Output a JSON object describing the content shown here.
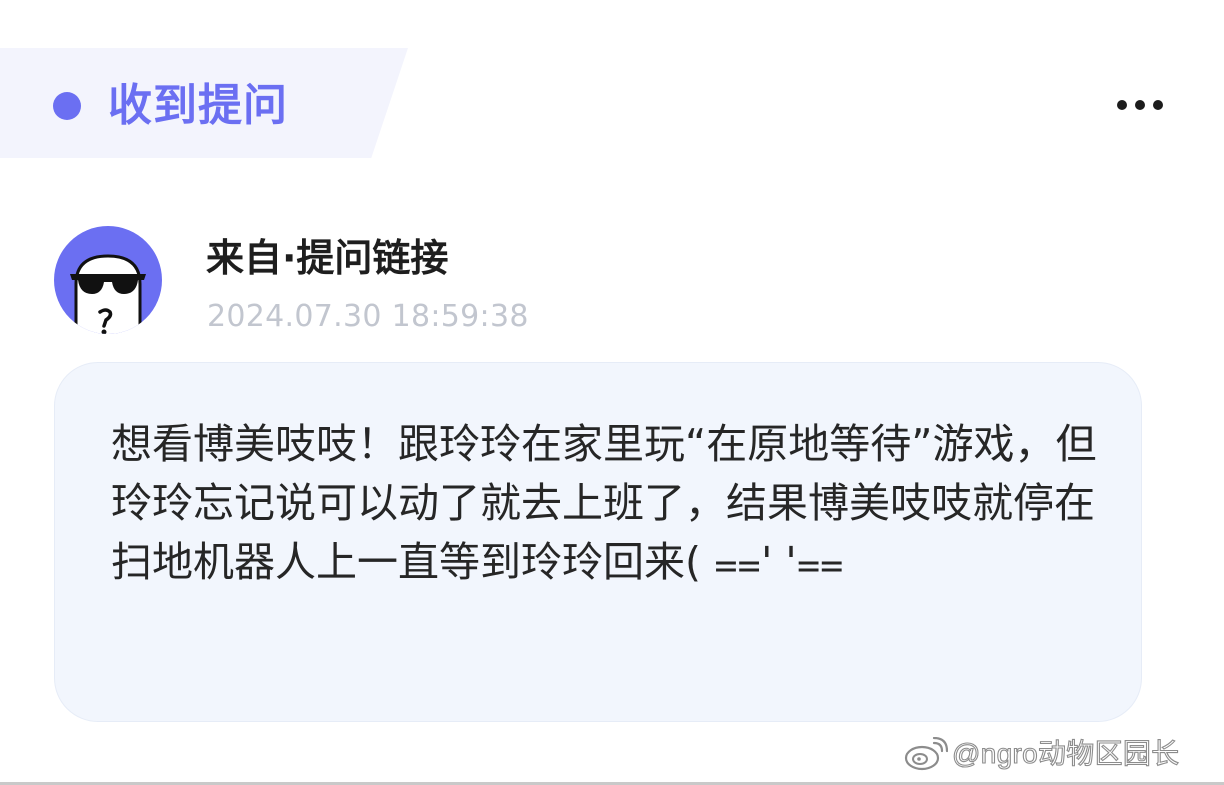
{
  "header": {
    "title": "收到提问"
  },
  "menu": {
    "icon": "more-horizontal-icon"
  },
  "sender": {
    "avatar_icon": "sunglasses-ghost-avatar",
    "name": "来自·提问链接",
    "timestamp": "2024.07.30 18:59:38"
  },
  "message": {
    "text": "想看博美吱吱！跟玲玲在家里玩“在原地等待”游戏，但玲玲忘记说可以动了就去上班了，结果博美吱吱就停在扫地机器人上一直等到玲玲回来( ⩵' '⩵"
  },
  "watermark": {
    "logo": "weibo-logo",
    "text": "@ngro动物区园长"
  },
  "colors": {
    "accent": "#6b6ff2",
    "card_background": "#f2f6fd",
    "header_background": "#f3f4fd",
    "timestamp": "#c2c6cf",
    "text": "#262626"
  }
}
